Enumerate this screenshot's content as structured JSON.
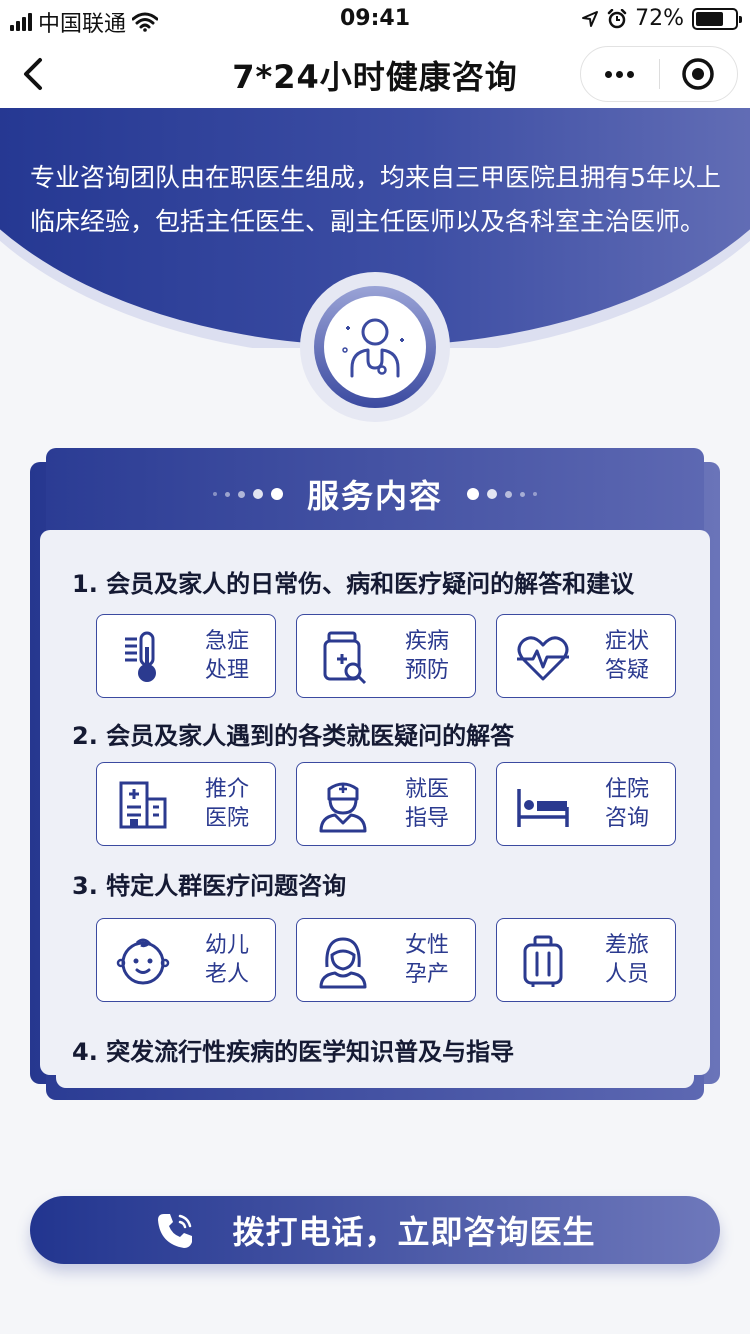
{
  "status_bar": {
    "carrier": "中国联通",
    "time": "09:41",
    "battery": "72%",
    "battery_level": 0.72
  },
  "nav": {
    "title": "7*24小时健康咨询"
  },
  "hero": {
    "description": "专业咨询团队由在职医生组成，均来自三甲医院且拥有5年以上临床经验，包括主任医生、副主任医师以及各科室主治医师。"
  },
  "card": {
    "title": "服务内容",
    "sections": [
      {
        "heading": "1. 会员及家人的日常伤、病和医疗疑问的解答和建议",
        "items": [
          {
            "label1": "急症",
            "label2": "处理",
            "icon": "thermometer-icon"
          },
          {
            "label1": "疾病",
            "label2": "预防",
            "icon": "medicine-bottle-icon"
          },
          {
            "label1": "症状",
            "label2": "答疑",
            "icon": "heartbeat-icon"
          }
        ]
      },
      {
        "heading": "2. 会员及家人遇到的各类就医疑问的解答",
        "items": [
          {
            "label1": "推介",
            "label2": "医院",
            "icon": "hospital-icon"
          },
          {
            "label1": "就医",
            "label2": "指导",
            "icon": "nurse-icon"
          },
          {
            "label1": "住院",
            "label2": "咨询",
            "icon": "bed-icon"
          }
        ]
      },
      {
        "heading": "3. 特定人群医疗问题咨询",
        "items": [
          {
            "label1": "幼儿",
            "label2": "老人",
            "icon": "baby-icon"
          },
          {
            "label1": "女性",
            "label2": "孕产",
            "icon": "woman-icon"
          },
          {
            "label1": "差旅",
            "label2": "人员",
            "icon": "luggage-icon"
          }
        ]
      },
      {
        "heading": "4. 突发流行性疾病的医学知识普及与指导",
        "items": []
      }
    ]
  },
  "call_button": {
    "label": "拨打电话，立即咨询医生",
    "icon": "phone-icon"
  },
  "colors": {
    "primary": "#21348f",
    "accent": "#6a74b9",
    "background": "#f5f6f9"
  }
}
